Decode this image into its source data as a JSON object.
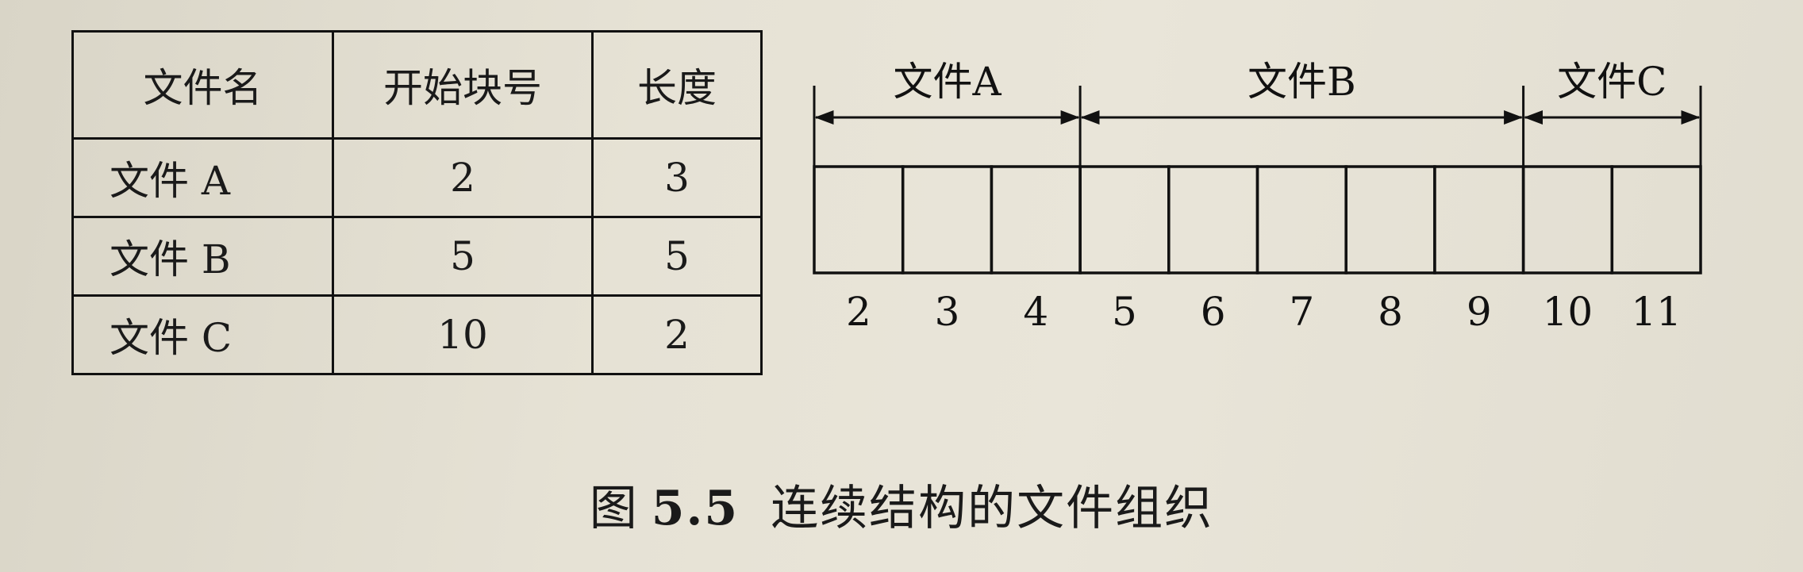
{
  "table": {
    "headers": [
      "文件名",
      "开始块号",
      "长度"
    ],
    "rows": [
      [
        "文件 A",
        "2",
        "3"
      ],
      [
        "文件 B",
        "5",
        "5"
      ],
      [
        "文件 C",
        "10",
        "2"
      ]
    ]
  },
  "diagram": {
    "files": [
      {
        "label": "文件A",
        "start": 2,
        "length": 3
      },
      {
        "label": "文件B",
        "start": 5,
        "length": 5
      },
      {
        "label": "文件C",
        "start": 10,
        "length": 2
      }
    ],
    "blocks": [
      "2",
      "3",
      "4",
      "5",
      "6",
      "7",
      "8",
      "9",
      "10",
      "11"
    ]
  },
  "caption": {
    "prefix": "图",
    "number": "5.5",
    "text": "连续结构的文件组织"
  },
  "colors": {
    "paper": "#e3dfd2",
    "ink": "#111111"
  }
}
